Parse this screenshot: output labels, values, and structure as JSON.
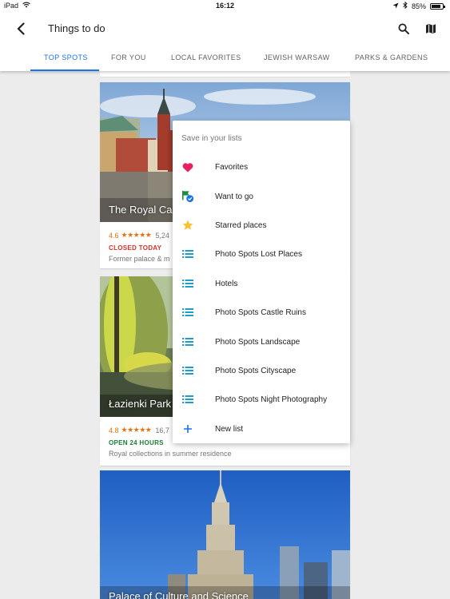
{
  "status_bar": {
    "device": "iPad",
    "time": "16:12",
    "battery": "85%",
    "battery_level": 0.85
  },
  "app_bar": {
    "title": "Things to do"
  },
  "tabs": [
    {
      "label": "TOP SPOTS",
      "active": true
    },
    {
      "label": "FOR YOU",
      "active": false
    },
    {
      "label": "LOCAL FAVORITES",
      "active": false
    },
    {
      "label": "JEWISH WARSAW",
      "active": false
    },
    {
      "label": "PARKS & GARDENS",
      "active": false
    }
  ],
  "cards": [
    {
      "name": "The Royal Cas",
      "rating": "4.6",
      "stars": "★★★★★",
      "reviews": "5,24",
      "status": "CLOSED TODAY",
      "description": "Former palace & m"
    },
    {
      "name": "Łazienki Park",
      "rating": "4.8",
      "stars": "★★★★★",
      "reviews": "16,7",
      "status": "OPEN 24 HOURS",
      "description": "Royal collections in summer residence"
    },
    {
      "name": "Palace of Culture and Science"
    }
  ],
  "menu": {
    "heading": "Save in your lists",
    "items": [
      {
        "label": "Favorites",
        "icon": "heart-icon"
      },
      {
        "label": "Want to go",
        "icon": "flag-check-icon"
      },
      {
        "label": "Starred places",
        "icon": "star-icon"
      },
      {
        "label": "Photo Spots Lost Places",
        "icon": "list-icon"
      },
      {
        "label": "Hotels",
        "icon": "list-icon"
      },
      {
        "label": "Photo Spots Castle Ruins",
        "icon": "list-icon"
      },
      {
        "label": "Photo Spots Landscape",
        "icon": "list-icon"
      },
      {
        "label": "Photo Spots Cityscape",
        "icon": "list-icon"
      },
      {
        "label": "Photo Spots Night Photography",
        "icon": "list-icon"
      },
      {
        "label": "New list",
        "icon": "plus-icon"
      }
    ]
  },
  "colors": {
    "accent": "#1a73e8",
    "closed": "#d93025",
    "open": "#188038",
    "rating": "#e8710a",
    "favorite": "#e91e63",
    "list": "#1e9ec4"
  }
}
